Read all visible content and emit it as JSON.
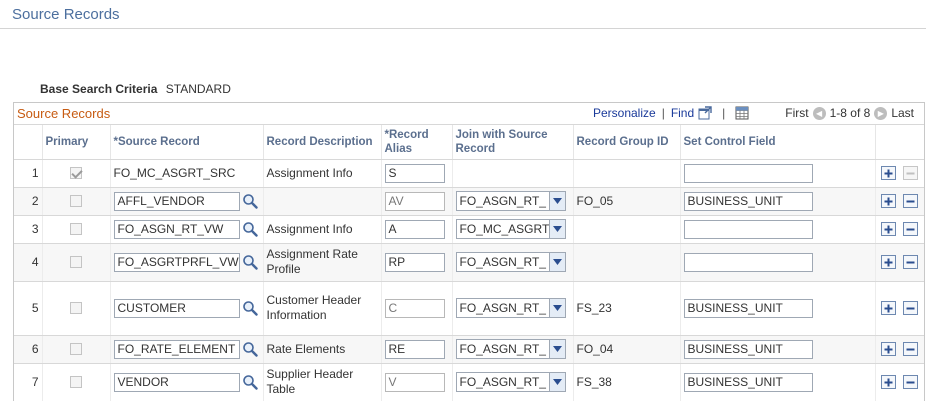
{
  "page": {
    "title": "Source Records"
  },
  "criteria": {
    "label": "Base Search Criteria",
    "value": "STANDARD"
  },
  "grid": {
    "title": "Source Records",
    "nav": {
      "personalize": "Personalize",
      "separator": "|",
      "find": "Find",
      "first": "First",
      "range": "1-8 of 8",
      "last": "Last"
    },
    "columns": {
      "primary": "Primary",
      "source_record": "*Source Record",
      "record_description": "Record Description",
      "record_alias": "*Record Alias",
      "join_with": "Join with Source Record",
      "record_group_id": "Record Group ID",
      "set_control_field": "Set Control Field"
    },
    "rows": [
      {
        "num": "1",
        "primary": true,
        "source_record": "FO_MC_ASGRT_SRC",
        "description": "Assignment Info",
        "alias": "S",
        "join": "",
        "group_id": "",
        "set_control": ""
      },
      {
        "num": "2",
        "primary": false,
        "source_record": "AFFL_VENDOR",
        "description": "",
        "alias": "AV",
        "join": "FO_ASGN_RT_",
        "group_id": "FO_05",
        "set_control": "BUSINESS_UNIT"
      },
      {
        "num": "3",
        "primary": false,
        "source_record": "FO_ASGN_RT_VW",
        "description": "Assignment Info",
        "alias": "A",
        "join": "FO_MC_ASGRT",
        "group_id": "",
        "set_control": ""
      },
      {
        "num": "4",
        "primary": false,
        "source_record": "FO_ASGRTPRFL_VW",
        "description": "Assignment Rate Profile",
        "alias": "RP",
        "join": "FO_ASGN_RT_",
        "group_id": "",
        "set_control": ""
      },
      {
        "num": "5",
        "primary": false,
        "source_record": "CUSTOMER",
        "description": "Customer Header Information",
        "alias": "C",
        "join": "FO_ASGN_RT_",
        "group_id": "FS_23",
        "set_control": "BUSINESS_UNIT"
      },
      {
        "num": "6",
        "primary": false,
        "source_record": "FO_RATE_ELEMENT",
        "description": "Rate Elements",
        "alias": "RE",
        "join": "FO_ASGN_RT_",
        "group_id": "FO_04",
        "set_control": "BUSINESS_UNIT"
      },
      {
        "num": "7",
        "primary": false,
        "source_record": "VENDOR",
        "description": "Supplier Header Table",
        "alias": "V",
        "join": "FO_ASGN_RT_",
        "group_id": "FS_38",
        "set_control": "BUSINESS_UNIT"
      }
    ]
  },
  "icons": {
    "lookup": "magnifier-icon",
    "add_row": "plus-icon",
    "delete_row": "minus-icon",
    "dropdown": "chevron-down-icon",
    "first": "arrow-left-icon",
    "last": "arrow-right-icon",
    "view_all": "new-window-icon",
    "download": "spreadsheet-icon"
  },
  "colors": {
    "title": "#4c6f9e",
    "grid_title": "#c75b12",
    "link": "#1a3a9a",
    "header_text": "#5b6f8e"
  }
}
